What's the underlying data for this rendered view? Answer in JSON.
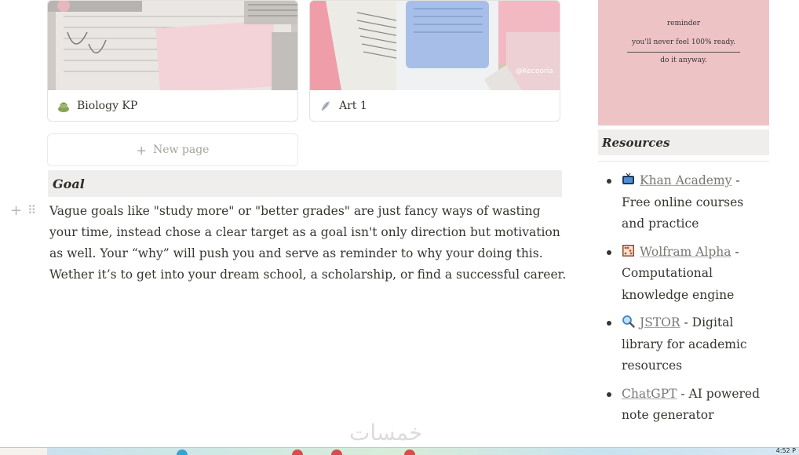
{
  "gallery": {
    "cards": [
      {
        "title": "Biology KP",
        "icon": "plant-icon"
      },
      {
        "title": "Art 1",
        "icon": "feather-icon",
        "cover_text": "@Kecooria"
      }
    ],
    "new_page_label": "New page"
  },
  "goal": {
    "heading": "Goal",
    "body": "Vague goals like \"study more\" or \"better grades\" are just fancy ways of wasting your time, instead chose a clear target as a goal isn't only direction but motivation as well. Your “why” will push you and serve as reminder to why your doing this. Wether it’s to get into your dream school, a scholarship, or find a successful career."
  },
  "quote_card": {
    "line1": "reminder",
    "line2": "you'll never feel 100% ready.",
    "line3": "do it anyway.",
    "background": "#edc3c6"
  },
  "resources": {
    "heading": "Resources",
    "items": [
      {
        "icon": "tv-icon",
        "link": "Khan Academy",
        "desc": " - Free online courses and practice"
      },
      {
        "icon": "abacus-icon",
        "link": "Wolfram Alpha",
        "desc": " - Computational knowledge engine"
      },
      {
        "icon": "magnifier-icon",
        "link": "JSTOR",
        "desc": " - Digital library for academic resources"
      },
      {
        "icon": "",
        "link": "ChatGPT",
        "desc": " - AI powered note generator"
      }
    ]
  },
  "watermark": "خمسات",
  "taskbar": {
    "clock": "4:52 P"
  },
  "colors": {
    "header_bg": "#efeeec",
    "text": "#37352f",
    "link": "#787774"
  }
}
